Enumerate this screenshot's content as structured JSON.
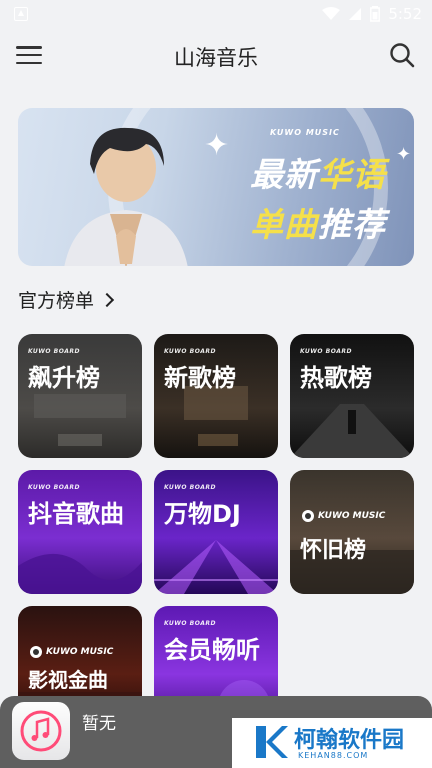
{
  "status_bar": {
    "time": "5:52"
  },
  "header": {
    "title": "山海音乐",
    "menu_icon": "hamburger-menu-icon",
    "search_icon": "search-icon"
  },
  "banner": {
    "brand": "KUWO MUSIC",
    "line1_a": "最新",
    "line1_b": "华语",
    "line2_a": "单曲",
    "line2_b": "推荐",
    "highlight_color": "#f5e04a"
  },
  "section": {
    "title": "官方榜单"
  },
  "charts": [
    {
      "title": "飙升榜",
      "brand": "KUWO BOARD"
    },
    {
      "title": "新歌榜",
      "brand": "KUWO BOARD"
    },
    {
      "title": "热歌榜",
      "brand": "KUWO BOARD"
    },
    {
      "title": "抖音歌曲",
      "brand": "KUWO BOARD"
    },
    {
      "title": "万物DJ",
      "brand": "KUWO BOARD"
    },
    {
      "title": "怀旧榜",
      "brand": "KUWO MUSIC"
    },
    {
      "title": "影视金曲",
      "brand": "KUWO MUSIC"
    },
    {
      "title": "会员畅听",
      "brand": "KUWO BOARD"
    }
  ],
  "player": {
    "title": "暂无",
    "art_icon": "music-note-icon"
  },
  "watermark": {
    "text": "柯翰软件园",
    "sub": "KEHAN88.COM"
  }
}
